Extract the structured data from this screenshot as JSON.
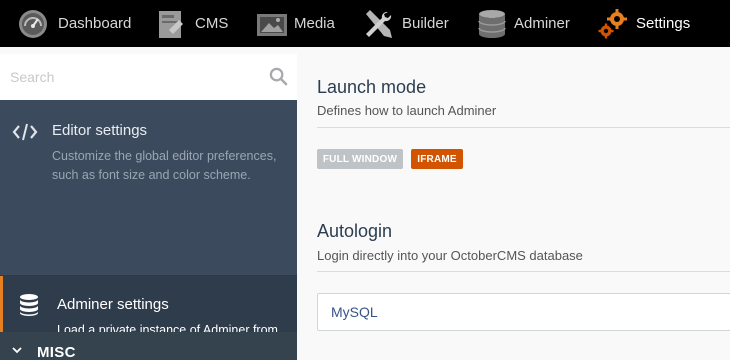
{
  "topnav": {
    "items": [
      {
        "label": "Dashboard",
        "icon": "dashboard-gauge-icon"
      },
      {
        "label": "CMS",
        "icon": "cms-document-icon"
      },
      {
        "label": "Media",
        "icon": "media-image-icon"
      },
      {
        "label": "Builder",
        "icon": "builder-tools-icon"
      },
      {
        "label": "Adminer",
        "icon": "adminer-database-icon"
      },
      {
        "label": "Settings",
        "icon": "settings-gears-icon",
        "active": true
      }
    ]
  },
  "sidebar": {
    "search": {
      "placeholder": "Search"
    },
    "items": [
      {
        "title": "Editor settings",
        "description": "Customize the global editor preferences, such as font size and color scheme.",
        "icon": "code-icon"
      },
      {
        "title": "Adminer settings",
        "description": "Load a private instance of Adminer from October backend",
        "icon": "database-icon",
        "active": true
      }
    ],
    "group": {
      "label": "MISC",
      "icon": "chevron-down-icon"
    }
  },
  "main": {
    "launch": {
      "title": "Launch mode",
      "description": "Defines how to launch Adminer",
      "options": [
        {
          "label": "FULL WINDOW",
          "selected": false
        },
        {
          "label": "IFRAME",
          "selected": true
        }
      ]
    },
    "autologin": {
      "title": "Autologin",
      "description": "Login directly into your OctoberCMS database",
      "value": "MySQL"
    }
  },
  "colors": {
    "topbar": "#000000",
    "sidebar": "#3b4a5c",
    "accent": "#d35400",
    "active_border": "#e67e22"
  }
}
